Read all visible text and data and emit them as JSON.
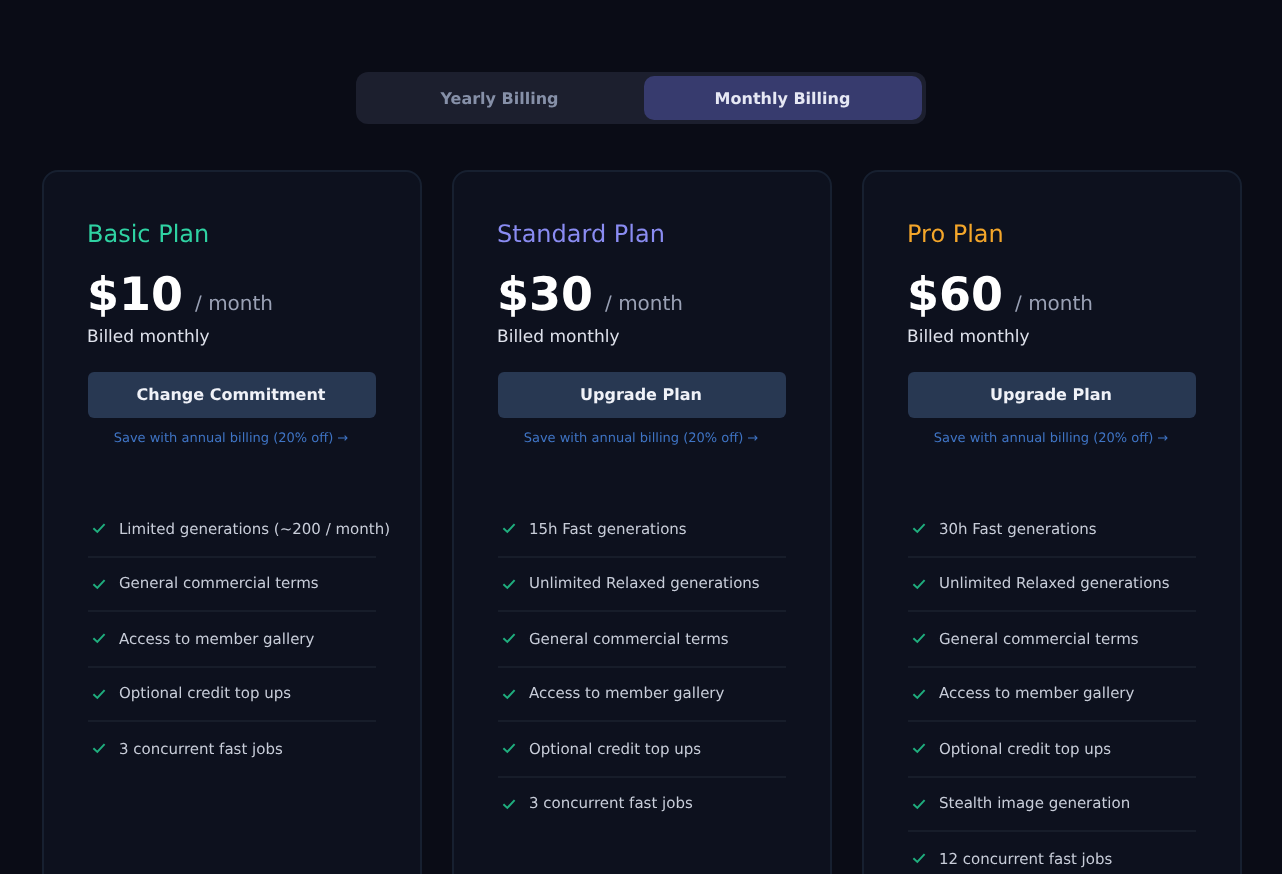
{
  "billing_toggle": [
    {
      "label": "Yearly Billing",
      "selected": false
    },
    {
      "label": "Monthly Billing",
      "selected": true
    }
  ],
  "plans": [
    {
      "name": "Basic Plan",
      "color": "#2fd3a3",
      "price": "$10",
      "period": "/ month",
      "billing_note": "Billed monthly",
      "button": "Change Commitment",
      "save_link": "Save with annual billing (20% off) →",
      "features": [
        "Limited generations (~200 / month)",
        "General commercial terms",
        "Access to member gallery",
        "Optional credit top ups",
        "3 concurrent fast jobs"
      ]
    },
    {
      "name": "Standard Plan",
      "color": "#8a8cf2",
      "price": "$30",
      "period": "/ month",
      "billing_note": "Billed monthly",
      "button": "Upgrade Plan",
      "save_link": "Save with annual billing (20% off) →",
      "features": [
        "15h Fast generations",
        "Unlimited Relaxed generations",
        "General commercial terms",
        "Access to member gallery",
        "Optional credit top ups",
        "3 concurrent fast jobs"
      ]
    },
    {
      "name": "Pro Plan",
      "color": "#f4a62a",
      "price": "$60",
      "period": "/ month",
      "billing_note": "Billed monthly",
      "button": "Upgrade Plan",
      "save_link": "Save with annual billing (20% off) →",
      "features": [
        "30h Fast generations",
        "Unlimited Relaxed generations",
        "General commercial terms",
        "Access to member gallery",
        "Optional credit top ups",
        "Stealth image generation",
        "12 concurrent fast jobs"
      ]
    }
  ]
}
